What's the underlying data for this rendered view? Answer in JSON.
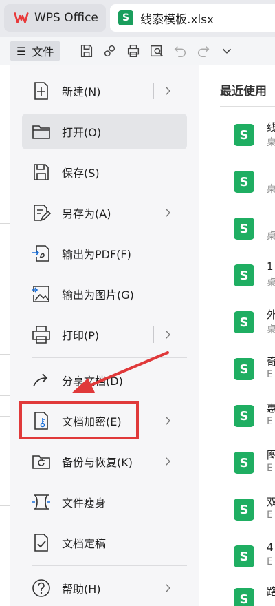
{
  "tabs": {
    "app_label": "WPS Office",
    "file_label": "线索模板.xlsx",
    "sheet_badge": "S"
  },
  "toolbar": {
    "file_menu_label": "文件",
    "icons": [
      "save-icon",
      "share-link-icon",
      "print-icon",
      "print-preview-icon",
      "undo-icon",
      "redo-icon",
      "chevron-down-icon"
    ]
  },
  "menu": {
    "items": [
      {
        "label": "新建(N)",
        "icon": "new-file-icon",
        "submenu": true
      },
      {
        "label": "打开(O)",
        "icon": "open-folder-icon",
        "submenu": false,
        "active": true
      },
      {
        "label": "保存(S)",
        "icon": "save-icon",
        "submenu": false
      },
      {
        "label": "另存为(A)",
        "icon": "save-as-icon",
        "submenu": true
      },
      {
        "label": "输出为PDF(F)",
        "icon": "export-pdf-icon",
        "submenu": false
      },
      {
        "label": "输出为图片(G)",
        "icon": "export-image-icon",
        "submenu": false
      },
      {
        "label": "打印(P)",
        "icon": "print-icon",
        "submenu": true
      },
      {
        "label": "分享文档(D)",
        "icon": "share-icon",
        "submenu": false
      },
      {
        "label": "文档加密(E)",
        "icon": "encrypt-icon",
        "submenu": true
      },
      {
        "label": "备份与恢复(K)",
        "icon": "backup-icon",
        "submenu": true
      },
      {
        "label": "文件瘦身",
        "icon": "slim-icon",
        "submenu": false
      },
      {
        "label": "文档定稿",
        "icon": "finalize-icon",
        "submenu": false
      },
      {
        "label": "帮助(H)",
        "icon": "help-icon",
        "submenu": true
      }
    ]
  },
  "recent": {
    "title": "最近使用",
    "badge": "S",
    "items": [
      {
        "name": "线",
        "location": "桌"
      },
      {
        "name": "",
        "location": "桌"
      },
      {
        "name": "",
        "location": "桌"
      },
      {
        "name": "1",
        "location": "桌"
      },
      {
        "name": "外",
        "location": "桌"
      },
      {
        "name": "奇",
        "location": "E"
      },
      {
        "name": "惠",
        "location": "E"
      },
      {
        "name": "图",
        "location": "E"
      },
      {
        "name": "双",
        "location": "E"
      },
      {
        "name": "4",
        "location": "E"
      },
      {
        "name": "路",
        "location": ""
      }
    ]
  },
  "colors": {
    "accent_red": "#e0393a",
    "sheet_green": "#1fae62",
    "wps_red": "#e8393a"
  }
}
